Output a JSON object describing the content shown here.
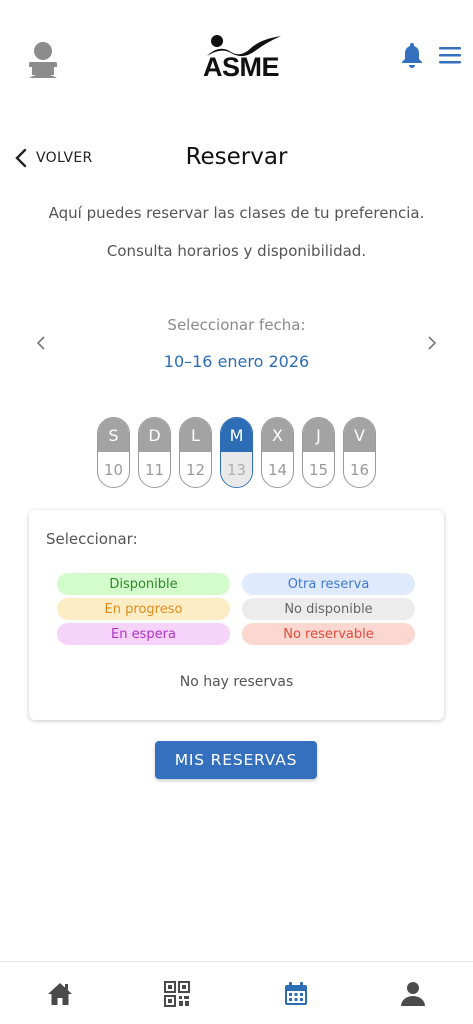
{
  "header": {
    "logo_text": "ASME",
    "icons": [
      "user-silhouette-icon",
      "bell-icon",
      "menu-icon"
    ]
  },
  "nav": {
    "back_label": "VOLVER"
  },
  "page": {
    "title": "Reservar",
    "description_line1": "Aquí puedes reservar las clases de tu preferencia.",
    "description_line2": "Consulta horarios y disponibilidad."
  },
  "date_picker": {
    "label": "Seleccionar fecha:",
    "range": "10–16 enero 2026",
    "days": [
      {
        "letter": "S",
        "number": "10",
        "selected": false
      },
      {
        "letter": "D",
        "number": "11",
        "selected": false
      },
      {
        "letter": "L",
        "number": "12",
        "selected": false
      },
      {
        "letter": "M",
        "number": "13",
        "selected": true
      },
      {
        "letter": "X",
        "number": "14",
        "selected": false
      },
      {
        "letter": "J",
        "number": "15",
        "selected": false
      },
      {
        "letter": "V",
        "number": "16",
        "selected": false
      }
    ]
  },
  "card": {
    "title": "Seleccionar:",
    "legend": {
      "disponible": "Disponible",
      "otra_reserva": "Otra reserva",
      "en_progreso": "En progreso",
      "no_disponible": "No disponible",
      "en_espera": "En espera",
      "no_reservable": "No reservable"
    },
    "empty_text": "No hay reservas"
  },
  "actions": {
    "mis_reservas_label": "MIS RESERVAS"
  },
  "tabbar": {
    "icons": [
      "home-icon",
      "qr-code-icon",
      "calendar-icon",
      "user-icon"
    ],
    "active": "calendar-icon"
  },
  "colors": {
    "accent": "#3470bd",
    "active_tab": "#2d6db6",
    "inactive_icon": "#4a4a4a"
  }
}
